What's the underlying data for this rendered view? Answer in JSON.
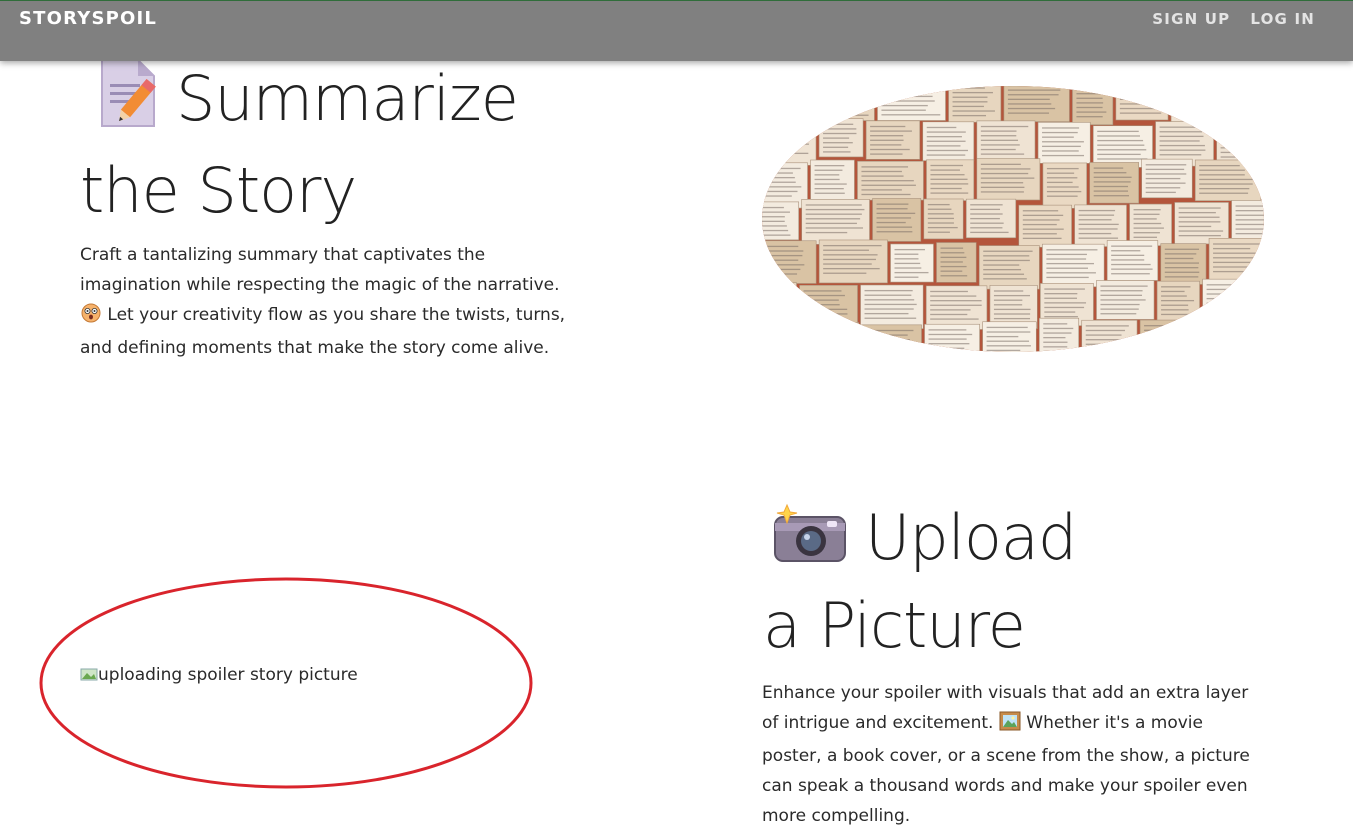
{
  "navbar": {
    "brand": "STORYSPOIL",
    "links": [
      "SIGN UP",
      "LOG IN"
    ]
  },
  "section_summarize": {
    "icon": "memo-pencil-icon",
    "heading": "Summarize the Story",
    "paragraph_before_icon": "Craft a tantalizing summary that captivates the imagination while respecting the magic of the narrative.",
    "inline_icon": "astonished-face-icon",
    "paragraph_after_icon": "Let your creativity flow as you share the twists, turns, and defining moments that make the story come alive.",
    "image": "books-collage-image"
  },
  "section_upload": {
    "icon": "camera-with-flash-icon",
    "heading": "Upload a Picture",
    "paragraph_before_icon": "Enhance your spoiler with visuals that add an extra layer of intrigue and excitement.",
    "inline_icon": "framed-picture-icon",
    "paragraph_after_icon": "Whether it's a movie poster, a book cover, or a scene from the show, a picture can speak a thousand words and make your spoiler even more compelling.",
    "broken_image_alt": "uploading spoiler story picture"
  },
  "colors": {
    "navbar_bg": "#808080",
    "annotation_red": "#d9242c",
    "text": "#222222"
  }
}
